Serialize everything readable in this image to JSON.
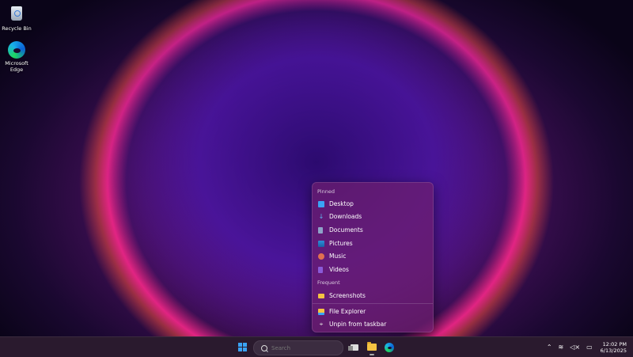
{
  "desktop": {
    "icons": [
      {
        "label": "Recycle Bin",
        "icon": "recycle-bin-icon"
      },
      {
        "label": "Microsoft Edge",
        "icon": "edge-icon"
      }
    ]
  },
  "jumplist": {
    "pinned_label": "Pinned",
    "pinned": [
      {
        "label": "Desktop",
        "icon": "desktop-folder-icon",
        "color": "#3aa3f5"
      },
      {
        "label": "Downloads",
        "icon": "download-icon",
        "color": "#5fb4f0"
      },
      {
        "label": "Documents",
        "icon": "documents-icon",
        "color": "#8ea2c8"
      },
      {
        "label": "Pictures",
        "icon": "pictures-icon",
        "color": "#2e8fd8"
      },
      {
        "label": "Music",
        "icon": "music-icon",
        "color": "#e07050"
      },
      {
        "label": "Videos",
        "icon": "videos-icon",
        "color": "#8a5ad8"
      }
    ],
    "frequent_label": "Frequent",
    "frequent": [
      {
        "label": "Screenshots",
        "icon": "folder-icon",
        "color": "#f5c242"
      }
    ],
    "actions": [
      {
        "label": "File Explorer",
        "icon": "file-explorer-icon",
        "color": "#f5c242"
      },
      {
        "label": "Unpin from taskbar",
        "icon": "unpin-icon",
        "color": "#dddddd"
      }
    ]
  },
  "taskbar": {
    "search_placeholder": "Search",
    "time": "12:02 PM",
    "date": "6/13/2025"
  }
}
